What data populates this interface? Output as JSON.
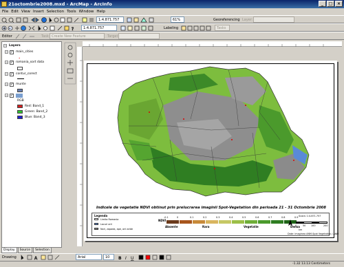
{
  "window": {
    "title": "21octombrie2008.mxd - ArcMap - ArcInfo",
    "controls": [
      "_",
      "□",
      "×"
    ]
  },
  "menu": [
    "File",
    "Edit",
    "View",
    "Insert",
    "Selection",
    "Tools",
    "Window",
    "Help"
  ],
  "toolbar1": {
    "scale": "1:4.871.757",
    "georef_label": "Georeferencing",
    "layer_label": "Layer:"
  },
  "toolbar2": {
    "scale_value": "1:4.871.757",
    "labeling": "Labeling",
    "dropdown": "Tasks"
  },
  "toolbar3": {
    "editor": "Editor",
    "task_label": "Task:",
    "task_value": "Create New Feature",
    "target_label": "Target:"
  },
  "zoom": "61%",
  "toc": {
    "header": "Layers",
    "layers": [
      {
        "name": "main_cities",
        "checked": true
      },
      {
        "name": "romania_sort data",
        "checked": true
      },
      {
        "name": "contur_corect",
        "checked": true
      },
      {
        "name": "munte",
        "checked": true
      },
      {
        "name": "",
        "checked": true
      }
    ],
    "rgb_label": "RGB",
    "bands": [
      "Red: Band_1",
      "Green: Band_2",
      "Blue: Band_3"
    ],
    "band_colors": [
      "#d42020",
      "#30c030",
      "#2020d0"
    ],
    "tabs": [
      "Display",
      "Source",
      "Selection"
    ]
  },
  "map": {
    "title": "Indicele de vegetatie NDVI obtinut prin prelucrarea imaginii Spot-Vegetation din perioada 21 - 31 Octombrie 2008",
    "legend": {
      "title": "Legenda",
      "items": [
        "Limita Romania",
        "Lacuri arii",
        "Nori, zapada, ape, arii aride"
      ],
      "ndvi_label": "NDVI",
      "ticks": [
        "-0.1",
        "0",
        "0.1",
        "0.2",
        "0.3",
        "0.4",
        "0.5",
        "0.6",
        "0.7",
        "0.8",
        "0.9"
      ],
      "ndvi_colors": [
        "#6b3b1c",
        "#a8561e",
        "#c88a3a",
        "#d9b55f",
        "#c6c865",
        "#9cbf48",
        "#6fae38",
        "#4b9a2c",
        "#2f7e22",
        "#1f6418"
      ],
      "classes": [
        "Absente",
        "Rara",
        "Vegetatie",
        "Densa"
      ],
      "scale_label": "Scara: 1:4.871.757",
      "scale_ticks": [
        "0",
        "50",
        "100",
        "200"
      ],
      "unit": "km",
      "credit": "Date: imaginea ANM-Spot Vegetation / ANM"
    }
  },
  "drawing": {
    "label": "Drawing",
    "font": "Arial",
    "size": "10"
  },
  "status": "-1.32 13.13 Centimeters",
  "colors": {
    "titlebar": "#0a246a",
    "veg_dark": "#2f7e22",
    "veg_light": "#7dbd3e",
    "gray": "#8a8a8a"
  }
}
